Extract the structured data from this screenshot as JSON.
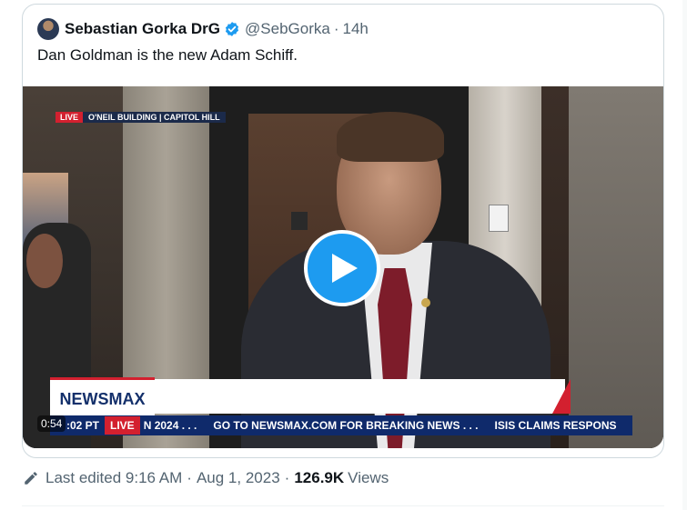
{
  "tweet": {
    "display_name": "Sebastian Gorka DrG",
    "handle": "@SebGorka",
    "separator": "·",
    "time": "14h",
    "text": "Dan Goldman is the new Adam Schiff."
  },
  "video": {
    "overlay_live": "LIVE",
    "overlay_location": "O'NEIL BUILDING | CAPITOL HILL",
    "network_logo": "NEWSMAX",
    "duration": "0:54",
    "ticker_clock": ":02 PT",
    "ticker_live": "LIVE",
    "ticker_items": [
      "N 2024 . . .",
      "GO TO NEWSMAX.COM FOR BREAKING NEWS . . .",
      "ISIS CLAIMS RESPONS"
    ]
  },
  "meta": {
    "edited_label": "Last edited 9:16 AM",
    "sep1": "·",
    "date": "Aug 1, 2023",
    "sep2": "·",
    "views_count": "126.9K",
    "views_label": "Views"
  },
  "colors": {
    "accent": "#1d9bf0",
    "text_secondary": "#536471",
    "live_red": "#d3202f",
    "newsmax_blue": "#0f2a6b"
  },
  "icons": [
    "verified-badge-icon",
    "play-icon",
    "pencil-icon"
  ]
}
